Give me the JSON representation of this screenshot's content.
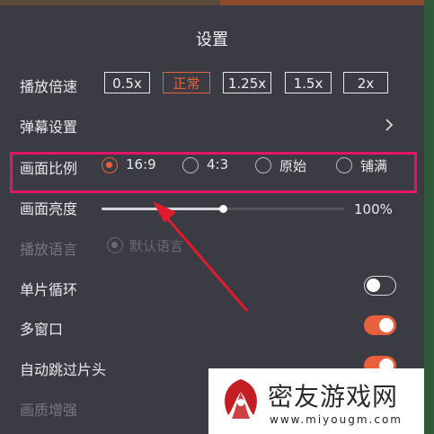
{
  "title": "设置",
  "speed": {
    "label": "播放倍速",
    "options": [
      "0.5x",
      "正常",
      "1.25x",
      "1.5x",
      "2x"
    ],
    "selected": "正常"
  },
  "danmaku": {
    "label": "弹幕设置"
  },
  "ratio": {
    "label": "画面比例",
    "options": [
      "16:9",
      "4:3",
      "原始",
      "铺满"
    ],
    "selected": "16:9"
  },
  "brightness": {
    "label": "画面亮度",
    "value_text": "100%",
    "level": 0.5
  },
  "language": {
    "label": "播放语言",
    "option": "默认语言"
  },
  "loop": {
    "label": "单片循环",
    "on": false
  },
  "multiwindow": {
    "label": "多窗口",
    "on": true
  },
  "skip_intro": {
    "label": "自动跳过片头",
    "on": true
  },
  "quality": {
    "label": "画质增强"
  },
  "watermark": {
    "name": "密友游戏网",
    "url": "www.miyougm.com"
  },
  "colors": {
    "accent": "#e8603c",
    "highlight": "#e6136a",
    "arrow": "#e21b2c",
    "panel": "#3b3b43"
  }
}
